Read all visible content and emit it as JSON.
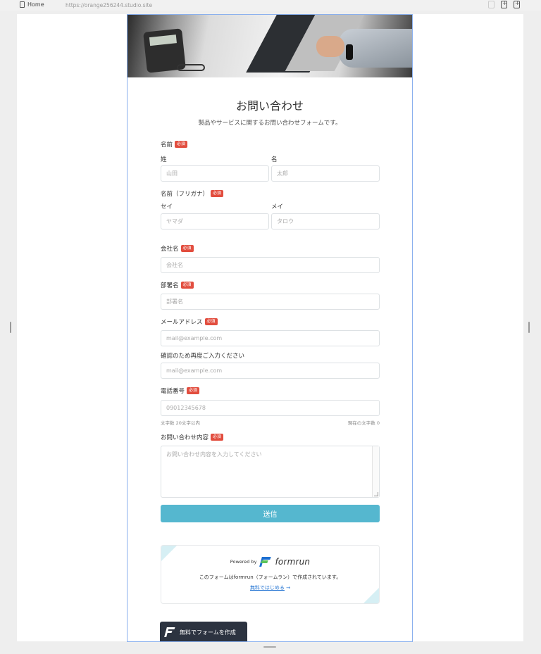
{
  "browser": {
    "page_name": "Home",
    "url": "https://orange256244.studio.site"
  },
  "form": {
    "title": "お問い合わせ",
    "subtitle": "製品やサービスに関するお問い合わせフォームです。",
    "required_badge": "必須",
    "name": {
      "label": "名前",
      "last_label": "姓",
      "last_placeholder": "山田",
      "first_label": "名",
      "first_placeholder": "太郎"
    },
    "kana": {
      "label": "名前（フリガナ）",
      "last_label": "セイ",
      "last_placeholder": "ヤマダ",
      "first_label": "メイ",
      "first_placeholder": "タロウ"
    },
    "company": {
      "label": "会社名",
      "placeholder": "会社名"
    },
    "department": {
      "label": "部署名",
      "placeholder": "部署名"
    },
    "email": {
      "label": "メールアドレス",
      "placeholder": "mail@example.com"
    },
    "email_confirm": {
      "label": "確認のため再度ご入力ください",
      "placeholder": "mail@example.com"
    },
    "phone": {
      "label": "電話番号",
      "placeholder": "09012345678",
      "limit_note": "文字数 20文字以内",
      "count_note": "現在の文字数 0"
    },
    "message": {
      "label": "お問い合わせ内容",
      "placeholder": "お問い合わせ内容を入力してください"
    },
    "submit_label": "送信"
  },
  "powered": {
    "by_text": "Powered by",
    "brand": "formrun",
    "description": "このフォームはformrun（フォームラン）で作成されています。",
    "link_text": "無料ではじめる",
    "link_arrow": "→"
  },
  "cta": {
    "label": "無料でフォームを作成"
  },
  "colors": {
    "accent": "#55b7cf",
    "required": "#e24d3e",
    "link": "#1b6fd1",
    "cta_bg": "#2c3340",
    "selection": "#8ab0ee"
  }
}
